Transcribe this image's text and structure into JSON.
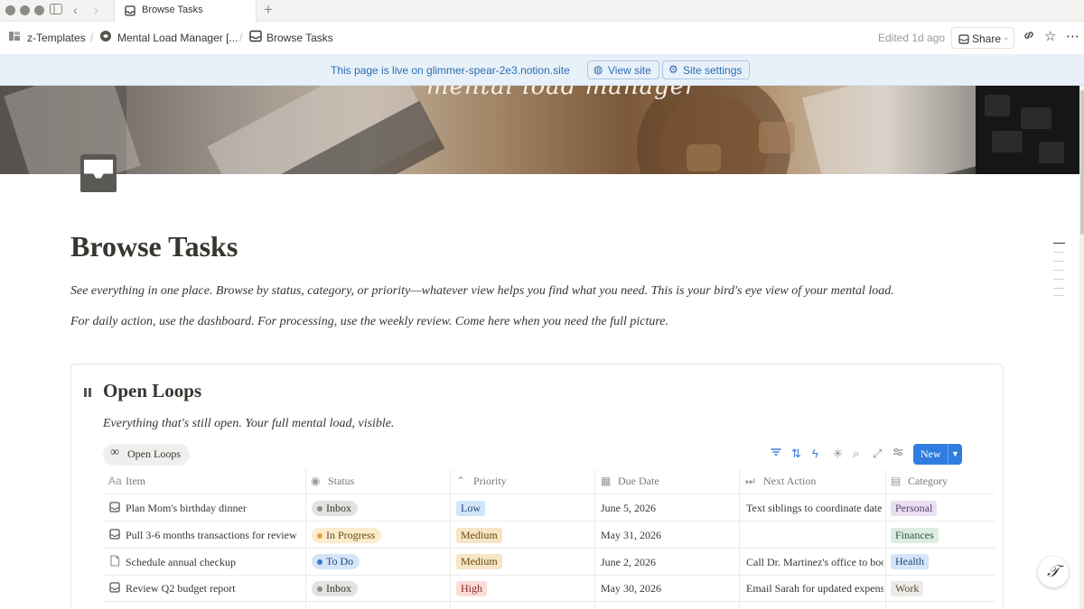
{
  "window": {
    "tab_title": "Browse Tasks",
    "new_tab_icon": "plus-icon"
  },
  "topbar": {
    "breadcrumbs": [
      {
        "label": "z-Templates",
        "icon": "templates-icon"
      },
      {
        "label": "Mental Load Manager [...",
        "icon": "brain-icon"
      },
      {
        "label": "Browse Tasks",
        "icon": "inbox-icon"
      }
    ],
    "edited": "Edited 1d ago",
    "share_label": "Share"
  },
  "banner": {
    "text": "This page is live on glimmer-spear-2e3.notion.site",
    "view_site": "View site",
    "site_settings": "Site settings"
  },
  "cover": {
    "title": "mental load manager"
  },
  "page": {
    "title": "Browse Tasks",
    "intro": "See everything in one place. Browse by status, category, or priority—whatever view helps you find what you need. This is your bird's eye view of your mental load.",
    "note": "For daily action, use the dashboard. For processing, use the weekly review. Come here when you need the full picture."
  },
  "database": {
    "title": "Open Loops",
    "description": "Everything that's still open. Your full mental load, visible.",
    "view_tab": "Open Loops",
    "new_label": "New",
    "columns": [
      "Item",
      "Status",
      "Priority",
      "Due Date",
      "Next Action",
      "Category"
    ],
    "rows": [
      {
        "item": "Plan Mom's birthday dinner",
        "status": "Inbox",
        "priority": "Low",
        "due": "June 5, 2026",
        "next_action": "Text siblings to coordinate date",
        "category": "Personal"
      },
      {
        "item": "Pull 3-6 months transactions for review",
        "status": "In Progress",
        "priority": "Medium",
        "due": "May 31, 2026",
        "next_action": "",
        "category": "Finances"
      },
      {
        "item": "Schedule annual checkup",
        "status": "To Do",
        "priority": "Medium",
        "due": "June 2, 2026",
        "next_action": "Call Dr. Martinez's office to boo",
        "category": "Health"
      },
      {
        "item": "Review Q2 budget report",
        "status": "Inbox",
        "priority": "High",
        "due": "May 30, 2026",
        "next_action": "Email Sarah for updated expens",
        "category": "Work"
      }
    ]
  },
  "colors": {
    "accent": "#2f7de1",
    "banner_bg": "#e8f1fa",
    "status_inbox": "#e3e2e0",
    "status_in_progress": "#fbeccd",
    "status_to_do": "#d3e5f7",
    "priority_low": "#d3e5f7",
    "priority_medium": "#f6e6c6",
    "priority_high": "#fbdcd8",
    "cat_personal": "#eadff2",
    "cat_finances": "#dcece1",
    "cat_health": "#d3e5f7",
    "cat_work": "#eeeae5"
  }
}
